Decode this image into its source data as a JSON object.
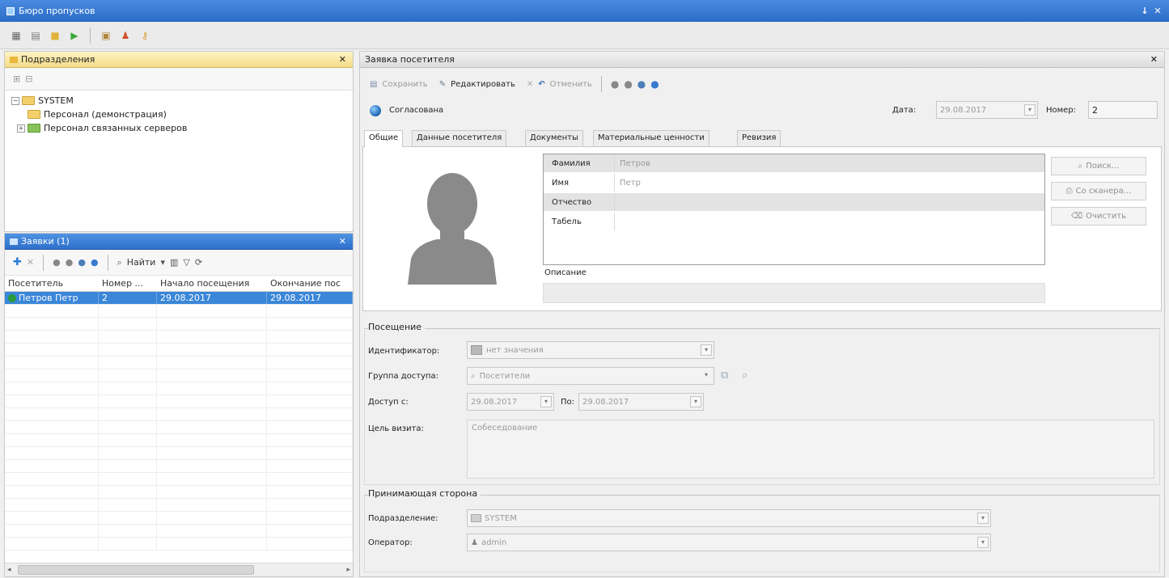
{
  "window": {
    "title": "Бюро пропусков",
    "btn_pin": "↓",
    "btn_close": "✕"
  },
  "left_top": {
    "title": "Подразделения",
    "tree": {
      "root": "SYSTEM",
      "children": [
        "Персонал (демонстрация)",
        "Персонал связанных серверов"
      ]
    }
  },
  "left_bottom": {
    "title": "Заявки (1)",
    "find_label": "Найти",
    "columns": [
      "Посетитель",
      "Номер ...",
      "Начало посещения",
      "Окончание пос"
    ],
    "rows": [
      [
        "Петров Петр",
        "2",
        "29.08.2017",
        "29.08.2017"
      ]
    ]
  },
  "right": {
    "title": "Заявка посетителя",
    "toolbar": {
      "save": "Сохранить",
      "edit": "Редактировать",
      "cancel": "Отменить"
    },
    "status": "Согласована",
    "date_label": "Дата:",
    "date_value": "29.08.2017",
    "number_label": "Номер:",
    "number_value": "2",
    "tabs": [
      "Общие",
      "Данные посетителя",
      "Документы",
      "Материальные ценности",
      "Ревизия"
    ],
    "active_tab": "Общие",
    "props": [
      {
        "key": "Фамилия",
        "value": "Петров"
      },
      {
        "key": "Имя",
        "value": "Петр"
      },
      {
        "key": "Отчество",
        "value": ""
      },
      {
        "key": "Табель",
        "value": ""
      }
    ],
    "photo_buttons": {
      "search": "Поиск...",
      "scanner": "Со сканера...",
      "clear": "Очистить"
    },
    "description_label": "Описание",
    "visit": {
      "title": "Посещение",
      "identifier_label": "Идентификатор:",
      "identifier_value": "нет значения",
      "group_label": "Группа доступа:",
      "group_value": "Посетители",
      "from_label": "Доступ с:",
      "from_value": "29.08.2017",
      "to_label": "По:",
      "to_value": "29.08.2017",
      "purpose_label": "Цель визита:",
      "purpose_value": "Собеседование"
    },
    "host": {
      "title": "Принимающая сторона",
      "dept_label": "Подразделение:",
      "dept_value": "SYSTEM",
      "operator_label": "Оператор:",
      "operator_value": "admin"
    }
  },
  "colors": {
    "title_blue": "#2b6bc6",
    "selection_blue": "#3a86d8",
    "header_yellow": "#f5dc86"
  }
}
